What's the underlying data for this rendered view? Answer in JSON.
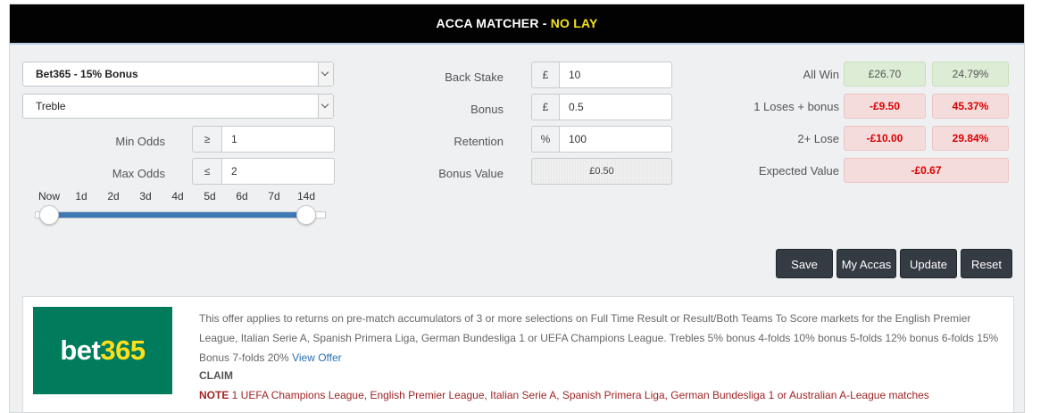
{
  "title": {
    "main": "ACCA MATCHER - ",
    "highlight": "NO LAY"
  },
  "offer_select": {
    "value": "Bet365 - 15% Bonus"
  },
  "type_select": {
    "value": "Treble"
  },
  "min_odds": {
    "label": "Min Odds",
    "symbol": "≥",
    "value": "1"
  },
  "max_odds": {
    "label": "Max Odds",
    "symbol": "≤",
    "value": "2"
  },
  "time_range": {
    "ticks": [
      "Now",
      "1d",
      "2d",
      "3d",
      "4d",
      "5d",
      "6d",
      "7d",
      "14d"
    ],
    "selected_from": "Now",
    "selected_to": "14d"
  },
  "back_stake": {
    "label": "Back Stake",
    "symbol": "£",
    "value": "10"
  },
  "bonus": {
    "label": "Bonus",
    "symbol": "£",
    "value": "0.5"
  },
  "retention": {
    "label": "Retention",
    "symbol": "%",
    "value": "100"
  },
  "bonus_value": {
    "label": "Bonus Value",
    "value": "£0.50"
  },
  "results": {
    "all_win": {
      "label": "All Win",
      "amount": "£26.70",
      "percent": "24.79%"
    },
    "one_loses": {
      "label": "1 Loses + bonus",
      "amount": "-£9.50",
      "percent": "45.37%"
    },
    "two_plus": {
      "label": "2+ Lose",
      "amount": "-£10.00",
      "percent": "29.84%"
    },
    "expected": {
      "label": "Expected Value",
      "amount": "-£0.67"
    }
  },
  "buttons": {
    "save": "Save",
    "my_accas": "My Accas",
    "update": "Update",
    "reset": "Reset"
  },
  "offer": {
    "logo_left": "bet",
    "logo_right": "365",
    "text": "This offer applies to returns on pre-match accumulators of 3 or more selections on Full Time Result or Result/Both Teams To Score markets for the English Premier League, Italian Serie A, Spanish Primera Liga, German Bundesliga 1 or UEFA Champions League. Trebles 5% bonus 4-folds 10% bonus 5-folds 12% bonus 6-folds 15% Bonus 7-folds 20%",
    "link": "View Offer",
    "claim": "CLAIM",
    "note_label": "NOTE",
    "note": " 1 UEFA Champions League, English Premier League, Italian Serie A, Spanish Primera Liga, German Bundesliga 1 or Australian A-League matches"
  },
  "colors": {
    "title_bg": "#020202",
    "highlight": "#f6e21c",
    "slider": "#3f79b5",
    "button": "#343b43",
    "logo_bg": "#007b5b",
    "negative": "#d90000"
  }
}
